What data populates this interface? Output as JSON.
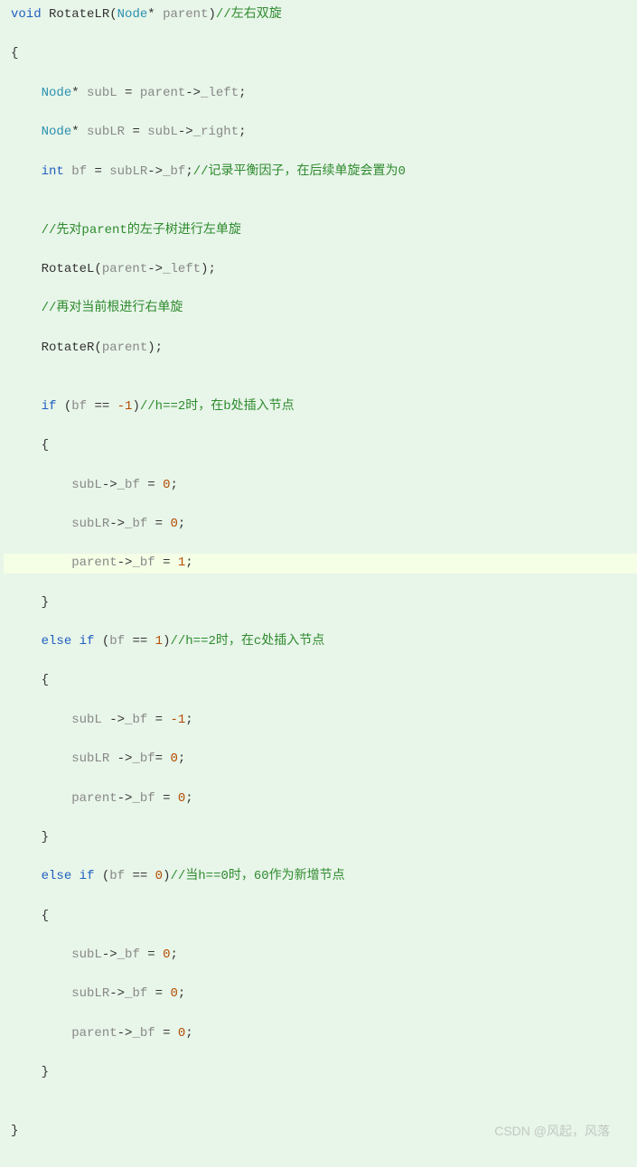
{
  "watermark": "CSDN @风起，风落",
  "lines": [
    [
      {
        "t": "kw",
        "v": "void"
      },
      {
        "t": "punct",
        "v": " "
      },
      {
        "t": "func",
        "v": "RotateLR"
      },
      {
        "t": "punct",
        "v": "("
      },
      {
        "t": "type",
        "v": "Node"
      },
      {
        "t": "punct",
        "v": "* "
      },
      {
        "t": "ident",
        "v": "parent"
      },
      {
        "t": "punct",
        "v": ")"
      },
      {
        "t": "comment",
        "v": "//左右双旋"
      }
    ],
    [
      {
        "t": "punct",
        "v": "{"
      }
    ],
    [
      {
        "t": "punct",
        "v": "    "
      },
      {
        "t": "type",
        "v": "Node"
      },
      {
        "t": "punct",
        "v": "* "
      },
      {
        "t": "ident",
        "v": "subL"
      },
      {
        "t": "punct",
        "v": " = "
      },
      {
        "t": "ident",
        "v": "parent"
      },
      {
        "t": "punct",
        "v": "->"
      },
      {
        "t": "ident",
        "v": "_left"
      },
      {
        "t": "punct",
        "v": ";"
      }
    ],
    [
      {
        "t": "punct",
        "v": "    "
      },
      {
        "t": "type",
        "v": "Node"
      },
      {
        "t": "punct",
        "v": "* "
      },
      {
        "t": "ident",
        "v": "subLR"
      },
      {
        "t": "punct",
        "v": " = "
      },
      {
        "t": "ident",
        "v": "subL"
      },
      {
        "t": "punct",
        "v": "->"
      },
      {
        "t": "ident",
        "v": "_right"
      },
      {
        "t": "punct",
        "v": ";"
      }
    ],
    [
      {
        "t": "punct",
        "v": "    "
      },
      {
        "t": "kw",
        "v": "int"
      },
      {
        "t": "punct",
        "v": " "
      },
      {
        "t": "ident",
        "v": "bf"
      },
      {
        "t": "punct",
        "v": " = "
      },
      {
        "t": "ident",
        "v": "subLR"
      },
      {
        "t": "punct",
        "v": "->"
      },
      {
        "t": "ident",
        "v": "_bf"
      },
      {
        "t": "punct",
        "v": ";"
      },
      {
        "t": "comment",
        "v": "//记录平衡因子，在后续单旋会置为0"
      }
    ],
    [
      {
        "t": "punct",
        "v": ""
      }
    ],
    [
      {
        "t": "punct",
        "v": "    "
      },
      {
        "t": "comment",
        "v": "//先对parent的左子树进行左单旋"
      }
    ],
    [
      {
        "t": "punct",
        "v": "    "
      },
      {
        "t": "func",
        "v": "RotateL"
      },
      {
        "t": "punct",
        "v": "("
      },
      {
        "t": "ident",
        "v": "parent"
      },
      {
        "t": "punct",
        "v": "->"
      },
      {
        "t": "ident",
        "v": "_left"
      },
      {
        "t": "punct",
        "v": ");"
      }
    ],
    [
      {
        "t": "punct",
        "v": "    "
      },
      {
        "t": "comment",
        "v": "//再对当前根进行右单旋"
      }
    ],
    [
      {
        "t": "punct",
        "v": "    "
      },
      {
        "t": "func",
        "v": "RotateR"
      },
      {
        "t": "punct",
        "v": "("
      },
      {
        "t": "ident",
        "v": "parent"
      },
      {
        "t": "punct",
        "v": ");"
      }
    ],
    [
      {
        "t": "punct",
        "v": ""
      }
    ],
    [
      {
        "t": "punct",
        "v": "    "
      },
      {
        "t": "kw",
        "v": "if"
      },
      {
        "t": "punct",
        "v": " ("
      },
      {
        "t": "ident",
        "v": "bf"
      },
      {
        "t": "punct",
        "v": " == "
      },
      {
        "t": "num",
        "v": "-1"
      },
      {
        "t": "punct",
        "v": ")"
      },
      {
        "t": "comment",
        "v": "//h==2时，在b处插入节点"
      }
    ],
    [
      {
        "t": "punct",
        "v": "    {"
      }
    ],
    [
      {
        "t": "punct",
        "v": "        "
      },
      {
        "t": "ident",
        "v": "subL"
      },
      {
        "t": "punct",
        "v": "->"
      },
      {
        "t": "ident",
        "v": "_bf"
      },
      {
        "t": "punct",
        "v": " = "
      },
      {
        "t": "num",
        "v": "0"
      },
      {
        "t": "punct",
        "v": ";"
      }
    ],
    [
      {
        "t": "punct",
        "v": "        "
      },
      {
        "t": "ident",
        "v": "subLR"
      },
      {
        "t": "punct",
        "v": "->"
      },
      {
        "t": "ident",
        "v": "_bf"
      },
      {
        "t": "punct",
        "v": " = "
      },
      {
        "t": "num",
        "v": "0"
      },
      {
        "t": "punct",
        "v": ";"
      }
    ],
    [
      {
        "t": "punct",
        "v": "        "
      },
      {
        "t": "ident",
        "v": "parent"
      },
      {
        "t": "punct",
        "v": "->"
      },
      {
        "t": "ident",
        "v": "_bf"
      },
      {
        "t": "punct",
        "v": " = "
      },
      {
        "t": "num",
        "v": "1"
      },
      {
        "t": "punct",
        "v": ";"
      }
    ],
    [
      {
        "t": "punct",
        "v": "    }"
      }
    ],
    [
      {
        "t": "punct",
        "v": "    "
      },
      {
        "t": "kw",
        "v": "else if"
      },
      {
        "t": "punct",
        "v": " ("
      },
      {
        "t": "ident",
        "v": "bf"
      },
      {
        "t": "punct",
        "v": " == "
      },
      {
        "t": "num",
        "v": "1"
      },
      {
        "t": "punct",
        "v": ")"
      },
      {
        "t": "comment",
        "v": "//h==2时，在c处插入节点"
      }
    ],
    [
      {
        "t": "punct",
        "v": "    {"
      }
    ],
    [
      {
        "t": "punct",
        "v": "        "
      },
      {
        "t": "ident",
        "v": "subL"
      },
      {
        "t": "punct",
        "v": " ->"
      },
      {
        "t": "ident",
        "v": "_bf"
      },
      {
        "t": "punct",
        "v": " = "
      },
      {
        "t": "num",
        "v": "-1"
      },
      {
        "t": "punct",
        "v": ";"
      }
    ],
    [
      {
        "t": "punct",
        "v": "        "
      },
      {
        "t": "ident",
        "v": "subLR"
      },
      {
        "t": "punct",
        "v": " ->"
      },
      {
        "t": "ident",
        "v": "_bf"
      },
      {
        "t": "punct",
        "v": "= "
      },
      {
        "t": "num",
        "v": "0"
      },
      {
        "t": "punct",
        "v": ";"
      }
    ],
    [
      {
        "t": "punct",
        "v": "        "
      },
      {
        "t": "ident",
        "v": "parent"
      },
      {
        "t": "punct",
        "v": "->"
      },
      {
        "t": "ident",
        "v": "_bf"
      },
      {
        "t": "punct",
        "v": " = "
      },
      {
        "t": "num",
        "v": "0"
      },
      {
        "t": "punct",
        "v": ";"
      }
    ],
    [
      {
        "t": "punct",
        "v": "    }"
      }
    ],
    [
      {
        "t": "punct",
        "v": "    "
      },
      {
        "t": "kw",
        "v": "else if"
      },
      {
        "t": "punct",
        "v": " ("
      },
      {
        "t": "ident",
        "v": "bf"
      },
      {
        "t": "punct",
        "v": " == "
      },
      {
        "t": "num",
        "v": "0"
      },
      {
        "t": "punct",
        "v": ")"
      },
      {
        "t": "comment",
        "v": "//当h==0时，60作为新增节点"
      }
    ],
    [
      {
        "t": "punct",
        "v": "    {"
      }
    ],
    [
      {
        "t": "punct",
        "v": "        "
      },
      {
        "t": "ident",
        "v": "subL"
      },
      {
        "t": "punct",
        "v": "->"
      },
      {
        "t": "ident",
        "v": "_bf"
      },
      {
        "t": "punct",
        "v": " = "
      },
      {
        "t": "num",
        "v": "0"
      },
      {
        "t": "punct",
        "v": ";"
      }
    ],
    [
      {
        "t": "punct",
        "v": "        "
      },
      {
        "t": "ident",
        "v": "subLR"
      },
      {
        "t": "punct",
        "v": "->"
      },
      {
        "t": "ident",
        "v": "_bf"
      },
      {
        "t": "punct",
        "v": " = "
      },
      {
        "t": "num",
        "v": "0"
      },
      {
        "t": "punct",
        "v": ";"
      }
    ],
    [
      {
        "t": "punct",
        "v": "        "
      },
      {
        "t": "ident",
        "v": "parent"
      },
      {
        "t": "punct",
        "v": "->"
      },
      {
        "t": "ident",
        "v": "_bf"
      },
      {
        "t": "punct",
        "v": " = "
      },
      {
        "t": "num",
        "v": "0"
      },
      {
        "t": "punct",
        "v": ";"
      }
    ],
    [
      {
        "t": "punct",
        "v": "    }"
      }
    ],
    [
      {
        "t": "punct",
        "v": ""
      }
    ],
    [
      {
        "t": "punct",
        "v": "}"
      }
    ]
  ],
  "highlight_index": 15
}
